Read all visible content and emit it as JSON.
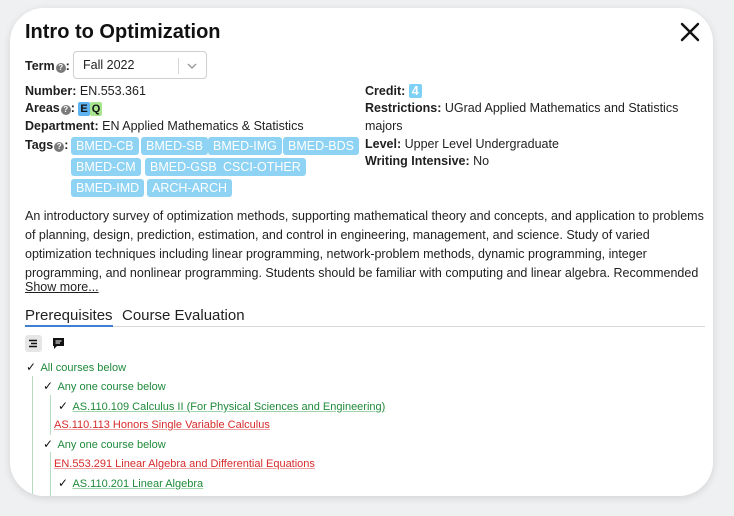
{
  "title": "Intro to Optimization",
  "term": {
    "label": "Term",
    "value": "Fall 2022"
  },
  "number": {
    "label": "Number:",
    "value": "EN.553.361"
  },
  "areas": {
    "label": "Areas",
    "badges": [
      "E",
      "Q"
    ]
  },
  "department": {
    "label": "Department:",
    "value": "EN Applied Mathematics & Statistics"
  },
  "tags": {
    "label": "Tags",
    "items": [
      "BMED-CB",
      "BMED-SB",
      "BMED-IMG",
      "BMED-BDS",
      "BMED-CM",
      "BMED-GSB",
      "CSCI-OTHER",
      "BMED-IMD",
      "ARCH-ARCH"
    ]
  },
  "credit": {
    "label": "Credit:",
    "value": "4"
  },
  "restrictions": {
    "label": "Restrictions:",
    "value": "UGrad Applied Mathematics and Statistics",
    "value2": "majors"
  },
  "level": {
    "label": "Level:",
    "value": "Upper Level Undergraduate"
  },
  "writing": {
    "label": "Writing Intensive:",
    "value": "No"
  },
  "description": "An introductory survey of optimization methods, supporting mathematical theory and concepts, and application to problems of planning, design, prediction, estimation, and control in engineering, management, and science. Study of varied optimization techniques including linear programming, network-problem methods, dynamic programming, integer programming, and nonlinear programming. Students should be familiar with computing and linear algebra. Recommended",
  "show_more": "Show more...",
  "tabs": [
    "Prerequisites",
    "Course Evaluation"
  ],
  "tree": {
    "all": "All courses below",
    "any1": "Any one course below",
    "c1": "AS.110.109 Calculus II (For Physical Sciences and Engineering)",
    "c2": "AS.110.113 Honors Single Variable Calculus",
    "any2": "Any one course below",
    "c3": "EN.553.291 Linear Algebra and Differential Equations",
    "c4": "AS.110.201 Linear Algebra"
  },
  "colors": {
    "tag": "#8fd3f4",
    "satisfied": "#1f8a3b",
    "unsatisfied": "#d62b2b",
    "tab_active": "#3f7fd6"
  }
}
